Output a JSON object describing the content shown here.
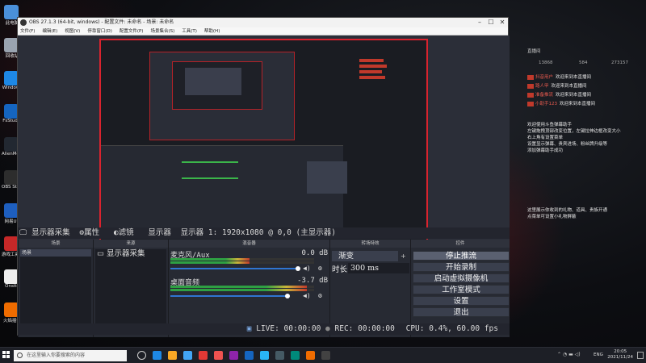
{
  "desktop": {
    "icons": [
      {
        "label": "此电脑",
        "icon": "computer-icon",
        "color": "#4a90d9"
      },
      {
        "label": "回收站",
        "icon": "recycle-bin-icon",
        "color": "#9aa4b0"
      },
      {
        "label": "Windows",
        "icon": "windows-icon",
        "color": "#1e88e5"
      },
      {
        "label": "FsStudio",
        "icon": "app-icon",
        "color": "#1565c0"
      },
      {
        "label": "AlienMode RECenter",
        "icon": "alien-icon",
        "color": "#222831"
      },
      {
        "label": "OBS Studio",
        "icon": "obs-icon",
        "color": "#2d2d2d"
      },
      {
        "label": "网易UU",
        "icon": "uu-icon",
        "color": "#1e5fbf"
      },
      {
        "label": "游戏工具 2021",
        "icon": "tool-icon",
        "color": "#c62828"
      },
      {
        "label": "Onsite",
        "icon": "onsite-icon",
        "color": "#eeeeee"
      },
      {
        "label": "火焰插件",
        "icon": "flame-icon",
        "color": "#ef6c00"
      }
    ]
  },
  "obs": {
    "title": "OBS 27.1.3 (64-bit, windows) - 配置文件: 未命名 - 场景: 未命名",
    "menu": [
      "文件(F)",
      "编辑(E)",
      "视图(V)",
      "停靠窗口(D)",
      "配置文件(P)",
      "场景集合(S)",
      "工具(T)",
      "帮助(H)"
    ],
    "source_bar": {
      "icon": "display-icon",
      "source_name": "显示器采集",
      "properties": "属性",
      "filters": "滤镜",
      "display_label": "显示器",
      "display_value": "显示器 1: 1920x1080 @ 0,0 (主显示器)"
    },
    "scenes": {
      "header": "场景",
      "items": [
        "场景"
      ],
      "footer": "+ − ⚙ ∧ ∨"
    },
    "sources": {
      "header": "来源",
      "items": [
        {
          "name": "显示器采集",
          "icon": "monitor-icon",
          "eye": "eye-icon",
          "lock": "lock-icon"
        }
      ],
      "footer": "+ − ⚙ ∧ ∨"
    },
    "mixer": {
      "header": "混音器",
      "channels": [
        {
          "name": "麦克风/Aux",
          "db": "0.0 dB",
          "level": 0.55,
          "volume": 1.0
        },
        {
          "name": "桌面音频",
          "db": "-3.7 dB",
          "level": 0.95,
          "volume": 0.92
        }
      ]
    },
    "transitions": {
      "header": "转场特效",
      "type": "渐变",
      "duration_label": "时长",
      "duration_value": "300 ms"
    },
    "controls": {
      "header": "控件",
      "buttons": [
        "停止推流",
        "开始录制",
        "启动虚拟摄像机",
        "工作室模式",
        "设置",
        "退出"
      ],
      "active_index": 0
    },
    "status": {
      "live": "LIVE: 00:00:00",
      "rec": "REC: 00:00:00",
      "cpu": "CPU: 0.4%, 60.00 fps"
    }
  },
  "chat": {
    "title": "直播间",
    "stats": [
      "13868",
      "584",
      "273157"
    ],
    "messages": [
      {
        "user": "抖音用户",
        "text": "欢迎来到本直播间"
      },
      {
        "user": "路人甲",
        "text": "欢迎来到本直播间"
      },
      {
        "user": "准备推流",
        "text": "欢迎来到本直播间"
      },
      {
        "user": "小助手123",
        "text": "欢迎来到本直播间"
      }
    ],
    "notice_lines": [
      "欢迎使用斗鱼弹幕助手",
      "左键拖拽顶部改变位置，左键拉伸边框改变大小",
      "右上角有设置菜单",
      "设置显示弹幕、贵宾进场、粉丝牌升级等",
      "添加弹幕助手成功"
    ],
    "footer_lines": [
      "这里展示你收到的礼物、道具、贵族开通",
      "点菜单可设置小礼物屏蔽"
    ]
  },
  "taskbar": {
    "search_placeholder": "在这里输入你要搜索的内容",
    "time": "20:05",
    "date": "2021/11/24",
    "lang": "ENG"
  }
}
